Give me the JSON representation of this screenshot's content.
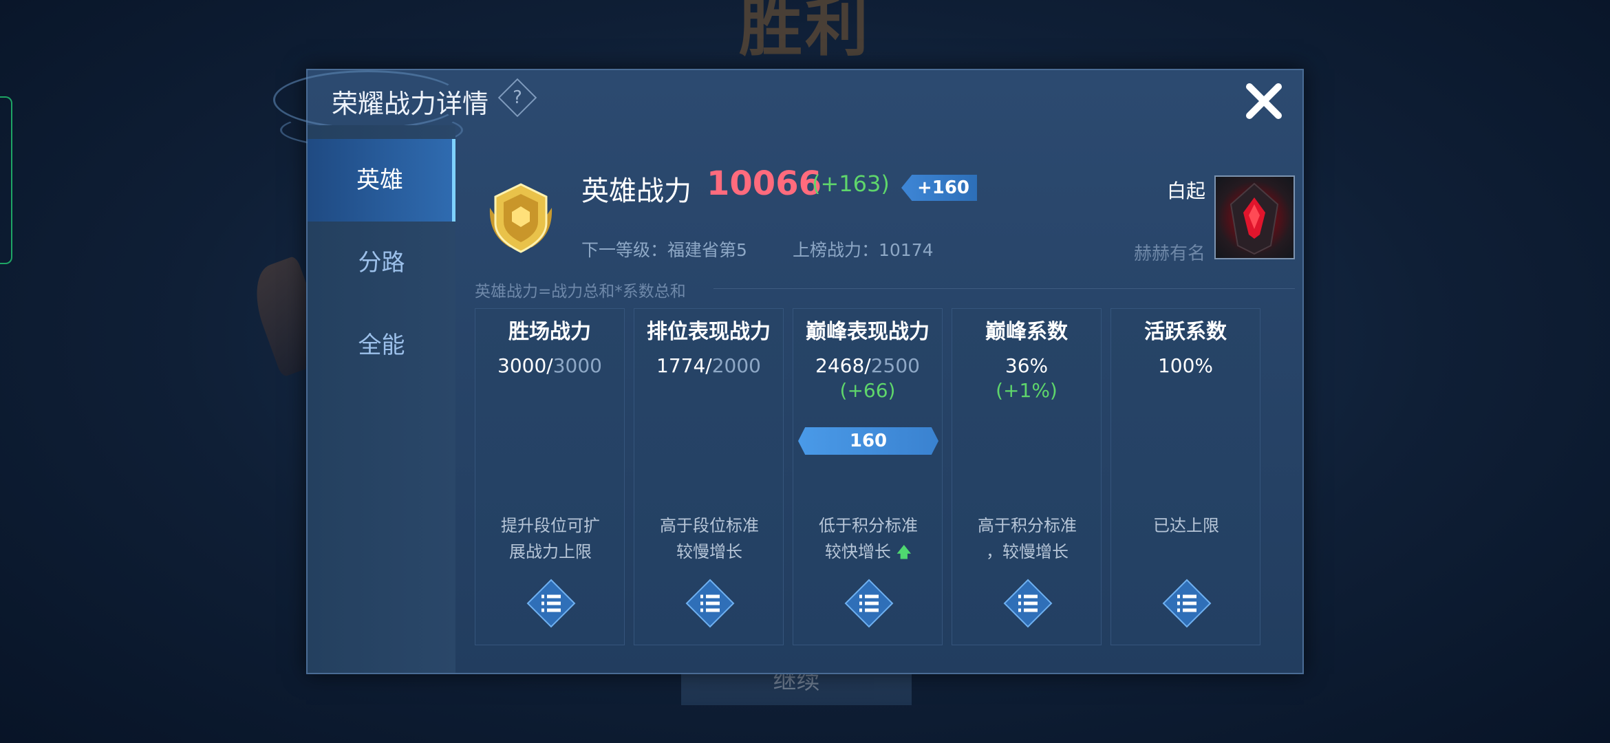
{
  "background": {
    "victory_text": "胜利",
    "continue_label": "继续"
  },
  "dialog": {
    "title": "荣耀战力详情",
    "help_symbol": "?",
    "close_icon": "close-icon"
  },
  "sidebar": {
    "items": [
      {
        "label": "英雄",
        "active": true
      },
      {
        "label": "分路",
        "active": false
      },
      {
        "label": "全能",
        "active": false
      }
    ]
  },
  "summary": {
    "label": "英雄战力",
    "value": "10066",
    "delta": "(+163)",
    "tag": "+160",
    "next_level": "下一等级：福建省第5",
    "rank_power": "上榜战力：10174",
    "hero_name": "白起",
    "hero_tier": "赫赫有名",
    "formula": "英雄战力=战力总和*系数总和"
  },
  "cards": [
    {
      "title": "胜场战力",
      "value": "3000/",
      "max": "3000",
      "delta": "",
      "badge": "",
      "note1": "提升段位可扩",
      "note2": "展战力上限",
      "arrow": ""
    },
    {
      "title": "排位表现战力",
      "value": "1774/",
      "max": "2000",
      "delta": "",
      "badge": "",
      "note1": "高于段位标准",
      "note2": "较慢增长",
      "arrow": ""
    },
    {
      "title": "巅峰表现战力",
      "value": "2468/",
      "max": "2500",
      "delta": "(+66)",
      "badge": "160",
      "note1": "低于积分标准",
      "note2": "较快增长",
      "arrow": "🡅"
    },
    {
      "title": "巅峰系数",
      "value": "36%",
      "max": "",
      "delta": "(+1%)",
      "badge": "",
      "note1": "高于积分标准",
      "note2": "，较慢增长",
      "arrow": ""
    },
    {
      "title": "活跃系数",
      "value": "100%",
      "max": "",
      "delta": "",
      "badge": "",
      "note1": "",
      "note2": "已达上限",
      "arrow": ""
    }
  ],
  "colors": {
    "power_value": "#ff6b7d",
    "positive_delta": "#5fd66b",
    "accent_blue": "#3e86d6"
  }
}
